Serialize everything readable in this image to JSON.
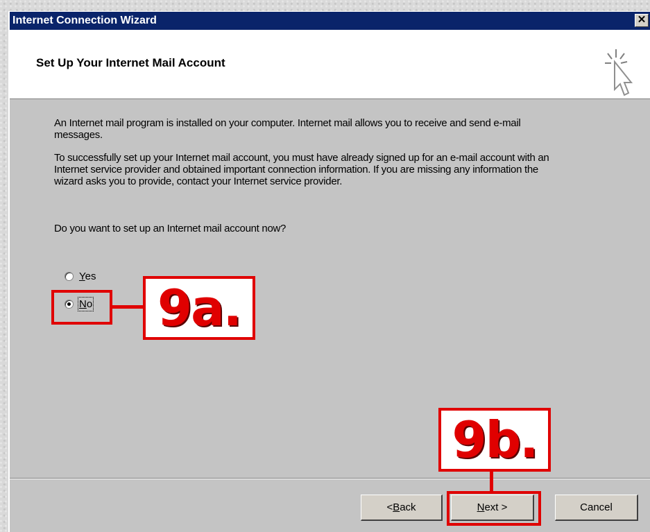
{
  "window": {
    "title": "Internet Connection Wizard",
    "close_glyph": "✕"
  },
  "header": {
    "title": "Set Up Your Internet Mail Account",
    "icon": "wizard-cursor-icon"
  },
  "body": {
    "paragraph1": "An Internet mail program is installed on your computer. Internet mail allows you to receive and send e-mail messages.",
    "paragraph2": "To successfully set up your Internet mail account, you must have already signed up for an e-mail account with an Internet service provider and obtained important connection information. If you are missing any information the wizard asks you to provide, contact your Internet service provider.",
    "question": "Do you want to set up an Internet mail account now?"
  },
  "options": {
    "yes": {
      "label_mnemonic": "Y",
      "label_rest": "es",
      "selected": false
    },
    "no": {
      "label_mnemonic": "N",
      "label_rest": "o",
      "selected": true
    }
  },
  "annotations": {
    "step_a": "9a.",
    "step_b": "9b.",
    "color": "#e00000"
  },
  "buttons": {
    "back": {
      "prefix": "< ",
      "mnemonic": "B",
      "rest": "ack"
    },
    "next": {
      "mnemonic": "N",
      "rest": "ext >"
    },
    "cancel": "Cancel"
  }
}
